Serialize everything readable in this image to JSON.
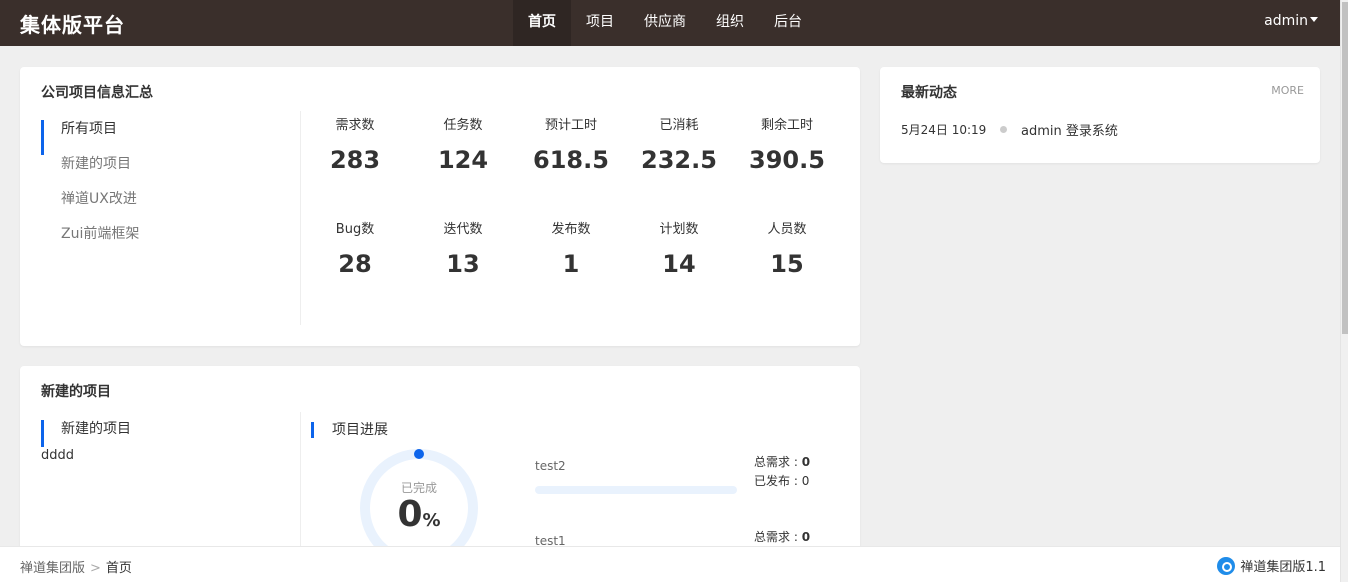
{
  "header": {
    "brand": "集体版平台",
    "nav": [
      {
        "label": "首页",
        "active": true
      },
      {
        "label": "项目",
        "active": false
      },
      {
        "label": "供应商",
        "active": false
      },
      {
        "label": "组织",
        "active": false
      },
      {
        "label": "后台",
        "active": false
      }
    ],
    "user": "admin"
  },
  "summary": {
    "title": "公司项目信息汇总",
    "projects": [
      "所有项目",
      "新建的项目",
      "禅道UX改进",
      "Zui前端框架"
    ],
    "stats": [
      {
        "label": "需求数",
        "value": "283"
      },
      {
        "label": "任务数",
        "value": "124"
      },
      {
        "label": "预计工时",
        "value": "618.5"
      },
      {
        "label": "已消耗",
        "value": "232.5"
      },
      {
        "label": "剩余工时",
        "value": "390.5"
      },
      {
        "label": "Bug数",
        "value": "28"
      },
      {
        "label": "迭代数",
        "value": "13"
      },
      {
        "label": "发布数",
        "value": "1"
      },
      {
        "label": "计划数",
        "value": "14"
      },
      {
        "label": "人员数",
        "value": "15"
      }
    ]
  },
  "activity": {
    "title": "最新动态",
    "more": "MORE",
    "items": [
      {
        "time": "5月24日 10:19",
        "text": "admin 登录系统"
      }
    ]
  },
  "project": {
    "title": "新建的项目",
    "side_item": "新建的项目",
    "sub_item": "dddd",
    "progress_title": "项目进展",
    "ring_caption": "已完成",
    "ring_value": "0",
    "ring_unit": "%",
    "ring_fraction": 0,
    "items": [
      {
        "name": "test2",
        "meta": [
          {
            "label": "总需求 : ",
            "value": "0"
          },
          {
            "label": "已发布 : ",
            "value": "0"
          }
        ],
        "progress": 0
      },
      {
        "name": "test1",
        "meta": [
          {
            "label": "总需求 : ",
            "value": "0"
          }
        ]
      }
    ]
  },
  "footer": {
    "crumbs": [
      "禅道集团版",
      "首页"
    ],
    "crumb_sep": ">",
    "version": "禅道集团版1.1"
  },
  "colors": {
    "header_bg": "#3a2f2b",
    "accent": "#0c64eb"
  }
}
